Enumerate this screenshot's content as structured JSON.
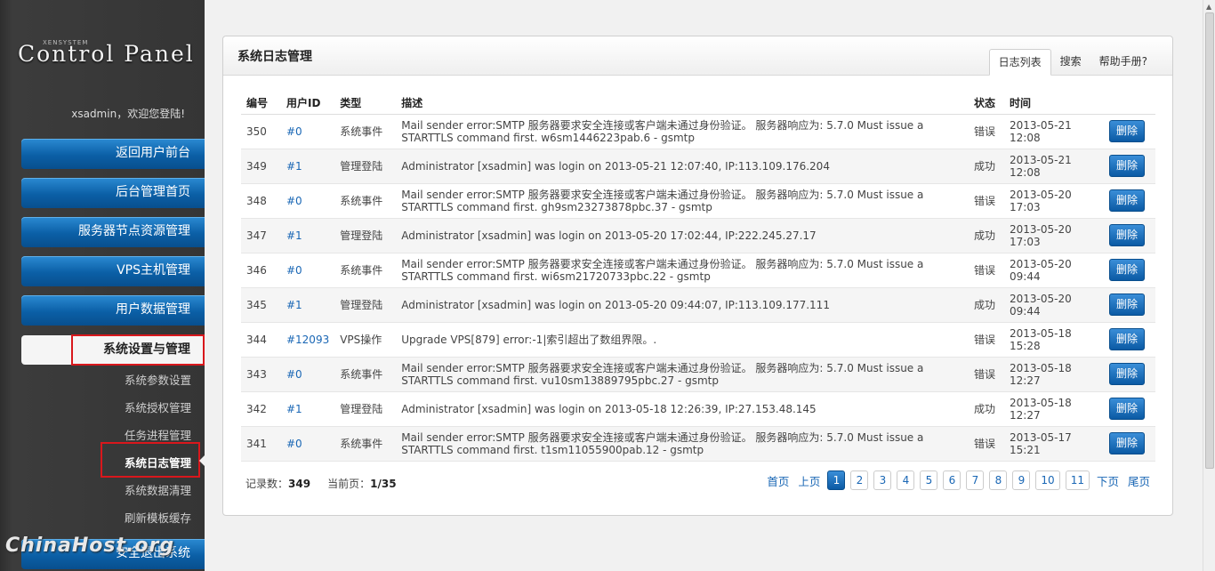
{
  "sidebar": {
    "logo_small": "XENSYSTEM",
    "logo": "Control Panel",
    "user": "xsadmin，欢迎您登陆!",
    "nav": [
      "返回用户前台",
      "后台管理首页",
      "服务器节点资源管理",
      "VPS主机管理",
      "用户数据管理"
    ],
    "active_section": "系统设置与管理",
    "sub_items": [
      "系统参数设置",
      "系统授权管理",
      "任务进程管理",
      "系统日志管理",
      "系统数据清理",
      "刷新模板缓存"
    ],
    "bottom_nav": "安全退出系统",
    "watermark": "ChinaHost.org"
  },
  "panel": {
    "title": "系统日志管理",
    "tabs": [
      "日志列表",
      "搜索",
      "帮助手册?"
    ],
    "columns": [
      "编号",
      "用户ID",
      "类型",
      "描述",
      "状态",
      "时间",
      ""
    ],
    "delete_label": "删除",
    "rows": [
      {
        "id": "350",
        "uid": "#0",
        "type": "系统事件",
        "desc": "Mail sender error:SMTP 服务器要求安全连接或客户端未通过身份验证。 服务器响应为: 5.7.0 Must issue a STARTTLS command first. w6sm1446223pab.6 - gsmtp",
        "status": "错误",
        "time": "2013-05-21 12:08"
      },
      {
        "id": "349",
        "uid": "#1",
        "type": "管理登陆",
        "desc": "Administrator [xsadmin] was login on 2013-05-21 12:07:40, IP:113.109.176.204",
        "status": "成功",
        "time": "2013-05-21 12:08"
      },
      {
        "id": "348",
        "uid": "#0",
        "type": "系统事件",
        "desc": "Mail sender error:SMTP 服务器要求安全连接或客户端未通过身份验证。 服务器响应为: 5.7.0 Must issue a STARTTLS command first. gh9sm23273878pbc.37 - gsmtp",
        "status": "错误",
        "time": "2013-05-20 17:03"
      },
      {
        "id": "347",
        "uid": "#1",
        "type": "管理登陆",
        "desc": "Administrator [xsadmin] was login on 2013-05-20 17:02:44, IP:222.245.27.17",
        "status": "成功",
        "time": "2013-05-20 17:03"
      },
      {
        "id": "346",
        "uid": "#0",
        "type": "系统事件",
        "desc": "Mail sender error:SMTP 服务器要求安全连接或客户端未通过身份验证。 服务器响应为: 5.7.0 Must issue a STARTTLS command first. wi6sm21720733pbc.22 - gsmtp",
        "status": "错误",
        "time": "2013-05-20 09:44"
      },
      {
        "id": "345",
        "uid": "#1",
        "type": "管理登陆",
        "desc": "Administrator [xsadmin] was login on 2013-05-20 09:44:07, IP:113.109.177.111",
        "status": "成功",
        "time": "2013-05-20 09:44"
      },
      {
        "id": "344",
        "uid": "#12093",
        "type": "VPS操作",
        "desc": "Upgrade VPS[879] error:-1|索引超出了数组界限。.",
        "status": "错误",
        "time": "2013-05-18 15:28"
      },
      {
        "id": "343",
        "uid": "#0",
        "type": "系统事件",
        "desc": "Mail sender error:SMTP 服务器要求安全连接或客户端未通过身份验证。 服务器响应为: 5.7.0 Must issue a STARTTLS command first. vu10sm13889795pbc.27 - gsmtp",
        "status": "错误",
        "time": "2013-05-18 12:27"
      },
      {
        "id": "342",
        "uid": "#1",
        "type": "管理登陆",
        "desc": "Administrator [xsadmin] was login on 2013-05-18 12:26:39, IP:27.153.48.145",
        "status": "成功",
        "time": "2013-05-18 12:27"
      },
      {
        "id": "341",
        "uid": "#0",
        "type": "系统事件",
        "desc": "Mail sender error:SMTP 服务器要求安全连接或客户端未通过身份验证。 服务器响应为: 5.7.0 Must issue a STARTTLS command first. t1sm11055900pab.12 - gsmtp",
        "status": "错误",
        "time": "2013-05-17 15:21"
      }
    ],
    "footer": {
      "records_label": "记录数：",
      "records": "349",
      "page_label": "当前页：",
      "page": "1/35"
    },
    "pager": {
      "first": "首页",
      "prev": "上页",
      "pages": [
        "1",
        "2",
        "3",
        "4",
        "5",
        "6",
        "7",
        "8",
        "9",
        "10",
        "11"
      ],
      "current": "1",
      "next": "下页",
      "last": "尾页"
    }
  }
}
